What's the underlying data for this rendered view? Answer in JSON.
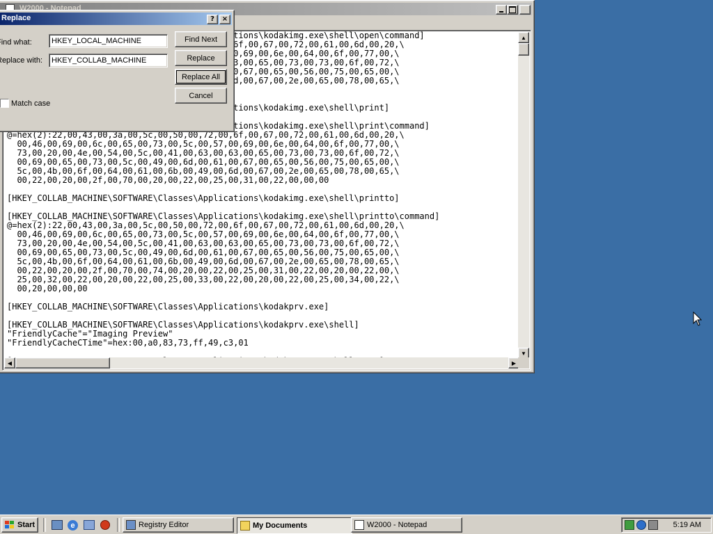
{
  "notepad": {
    "title": "W2000 - Notepad",
    "text": "[HKEY_COLLAB_MACHINE\\SOFTWARE\\Classes\\Applications\\kodakimg.exe\\shell\\open\\command]\n@=hex(2):22,00,43,00,3a,00,5c,00,50,00,72,00,6f,00,67,00,72,00,61,00,6d,00,20,\\\n  00,46,00,69,00,6c,00,65,00,73,00,5c,00,57,00,69,00,6e,00,64,00,6f,00,77,00,\\\n  73,00,20,00,4e,00,54,00,5c,00,41,00,63,00,63,00,65,00,73,00,73,00,6f,00,72,\\\n  00,69,00,65,00,73,00,5c,00,49,00,6d,00,61,00,67,00,65,00,56,00,75,00,65,00,\\\n  5c,00,4b,00,6f,00,64,00,61,00,6b,00,49,00,6d,00,67,00,2e,00,65,00,78,00,65,\\\n  00,20,00,22,00,25,00,31,00,22,00,00,00\n\n[HKEY_COLLAB_MACHINE\\SOFTWARE\\Classes\\Applications\\kodakimg.exe\\shell\\print]\n\n[HKEY_COLLAB_MACHINE\\SOFTWARE\\Classes\\Applications\\kodakimg.exe\\shell\\print\\command]\n@=hex(2):22,00,43,00,3a,00,5c,00,50,00,72,00,6f,00,67,00,72,00,61,00,6d,00,20,\\\n  00,46,00,69,00,6c,00,65,00,73,00,5c,00,57,00,69,00,6e,00,64,00,6f,00,77,00,\\\n  73,00,20,00,4e,00,54,00,5c,00,41,00,63,00,63,00,65,00,73,00,73,00,6f,00,72,\\\n  00,69,00,65,00,73,00,5c,00,49,00,6d,00,61,00,67,00,65,00,56,00,75,00,65,00,\\\n  5c,00,4b,00,6f,00,64,00,61,00,6b,00,49,00,6d,00,67,00,2e,00,65,00,78,00,65,\\\n  00,22,00,20,00,2f,00,70,00,20,00,22,00,25,00,31,00,22,00,00,00\n\n[HKEY_COLLAB_MACHINE\\SOFTWARE\\Classes\\Applications\\kodakimg.exe\\shell\\printto]\n\n[HKEY_COLLAB_MACHINE\\SOFTWARE\\Classes\\Applications\\kodakimg.exe\\shell\\printto\\command]\n@=hex(2):22,00,43,00,3a,00,5c,00,50,00,72,00,6f,00,67,00,72,00,61,00,6d,00,20,\\\n  00,46,00,69,00,6c,00,65,00,73,00,5c,00,57,00,69,00,6e,00,64,00,6f,00,77,00,\\\n  73,00,20,00,4e,00,54,00,5c,00,41,00,63,00,63,00,65,00,73,00,73,00,6f,00,72,\\\n  00,69,00,65,00,73,00,5c,00,49,00,6d,00,61,00,67,00,65,00,56,00,75,00,65,00,\\\n  5c,00,4b,00,6f,00,64,00,61,00,6b,00,49,00,6d,00,67,00,2e,00,65,00,78,00,65,\\\n  00,22,00,20,00,2f,00,70,00,74,00,20,00,22,00,25,00,31,00,22,00,20,00,22,00,\\\n  25,00,32,00,22,00,20,00,22,00,25,00,33,00,22,00,20,00,22,00,25,00,34,00,22,\\\n  00,20,00,00,00\n\n[HKEY_COLLAB_MACHINE\\SOFTWARE\\Classes\\Applications\\kodakprv.exe]\n\n[HKEY_COLLAB_MACHINE\\SOFTWARE\\Classes\\Applications\\kodakprv.exe\\shell]\n\"FriendlyCache\"=\"Imaging Preview\"\n\"FriendlyCacheCTime\"=hex:00,a0,83,73,ff,49,c3,01\n\n[HKEY_COLLAB_MACHINE\\SOFTWARE\\Classes\\Applications\\kodakprv.exe\\shell\\open]\n\n[\\SOFTWARE\\Classes\\Applications\\kodakprv.exe\\shell\\open\\command]"
  },
  "replace_dialog": {
    "title": "Replace",
    "help_glyph": "?",
    "close_glyph": "×",
    "find_label": "Find what:",
    "find_value": "HKEY_LOCAL_MACHINE",
    "replace_label": "Replace with:",
    "replace_value": "HKEY_COLLAB_MACHINE",
    "match_case_label": "Match case",
    "match_case_checked": false,
    "find_next": "Find Next",
    "replace": "Replace",
    "replace_all": "Replace All",
    "cancel": "Cancel"
  },
  "taskbar": {
    "start": "Start",
    "tasks": [
      "Registry Editor",
      "My Documents",
      "W2000 - Notepad"
    ],
    "clock": "5:19 AM"
  },
  "colors": {
    "desktop": "#3a6ea5",
    "active_title": "#0a246a",
    "inactive_title": "#808080",
    "face": "#d4d0c8"
  }
}
